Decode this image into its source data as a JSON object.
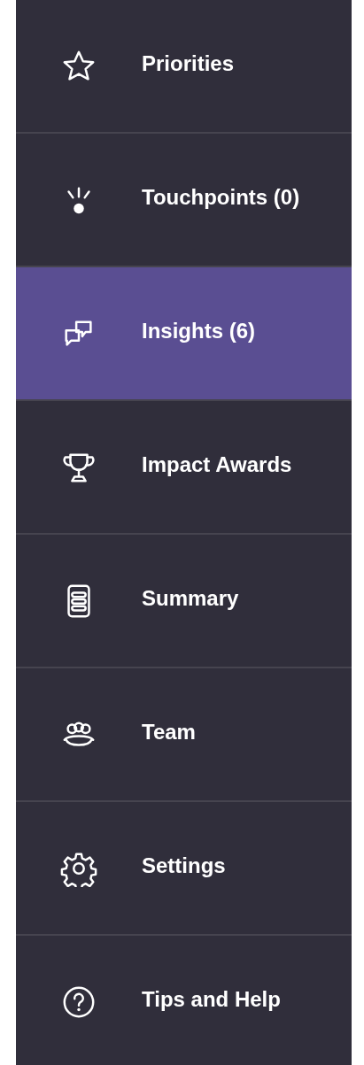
{
  "nav": {
    "items": [
      {
        "label": "Priorities",
        "selected": false
      },
      {
        "label": "Touchpoints (0)",
        "selected": false
      },
      {
        "label": "Insights (6)",
        "selected": true
      },
      {
        "label": "Impact Awards",
        "selected": false
      },
      {
        "label": "Summary",
        "selected": false
      },
      {
        "label": "Team",
        "selected": false
      },
      {
        "label": "Settings",
        "selected": false
      },
      {
        "label": "Tips and Help",
        "selected": false
      }
    ]
  }
}
